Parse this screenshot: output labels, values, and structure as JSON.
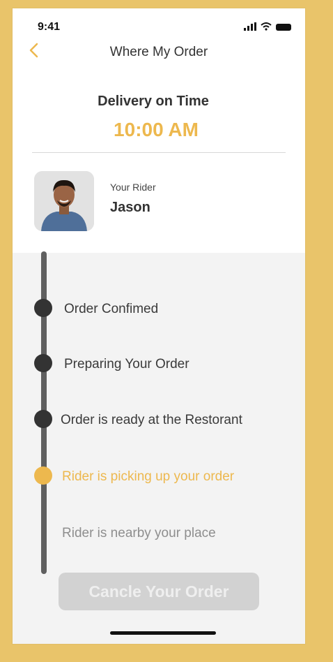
{
  "status_bar": {
    "time": "9:41"
  },
  "header": {
    "title": "Where My Order"
  },
  "delivery": {
    "label": "Delivery on Time",
    "time": "10:00 AM"
  },
  "rider": {
    "caption": "Your Rider",
    "name": "Jason"
  },
  "timeline": {
    "steps": [
      {
        "label": "Order Confimed",
        "state": "done"
      },
      {
        "label": "Preparing Your Order",
        "state": "done"
      },
      {
        "label": "Order is ready at the Restorant",
        "state": "done"
      },
      {
        "label": "Rider is picking up your order",
        "state": "active"
      },
      {
        "label": "Rider is nearby your place",
        "state": "pending"
      }
    ]
  },
  "actions": {
    "cancel_label": "Cancle Your Order"
  },
  "colors": {
    "accent": "#EDB84E",
    "background": "#E9C46A",
    "done": "#333333"
  }
}
